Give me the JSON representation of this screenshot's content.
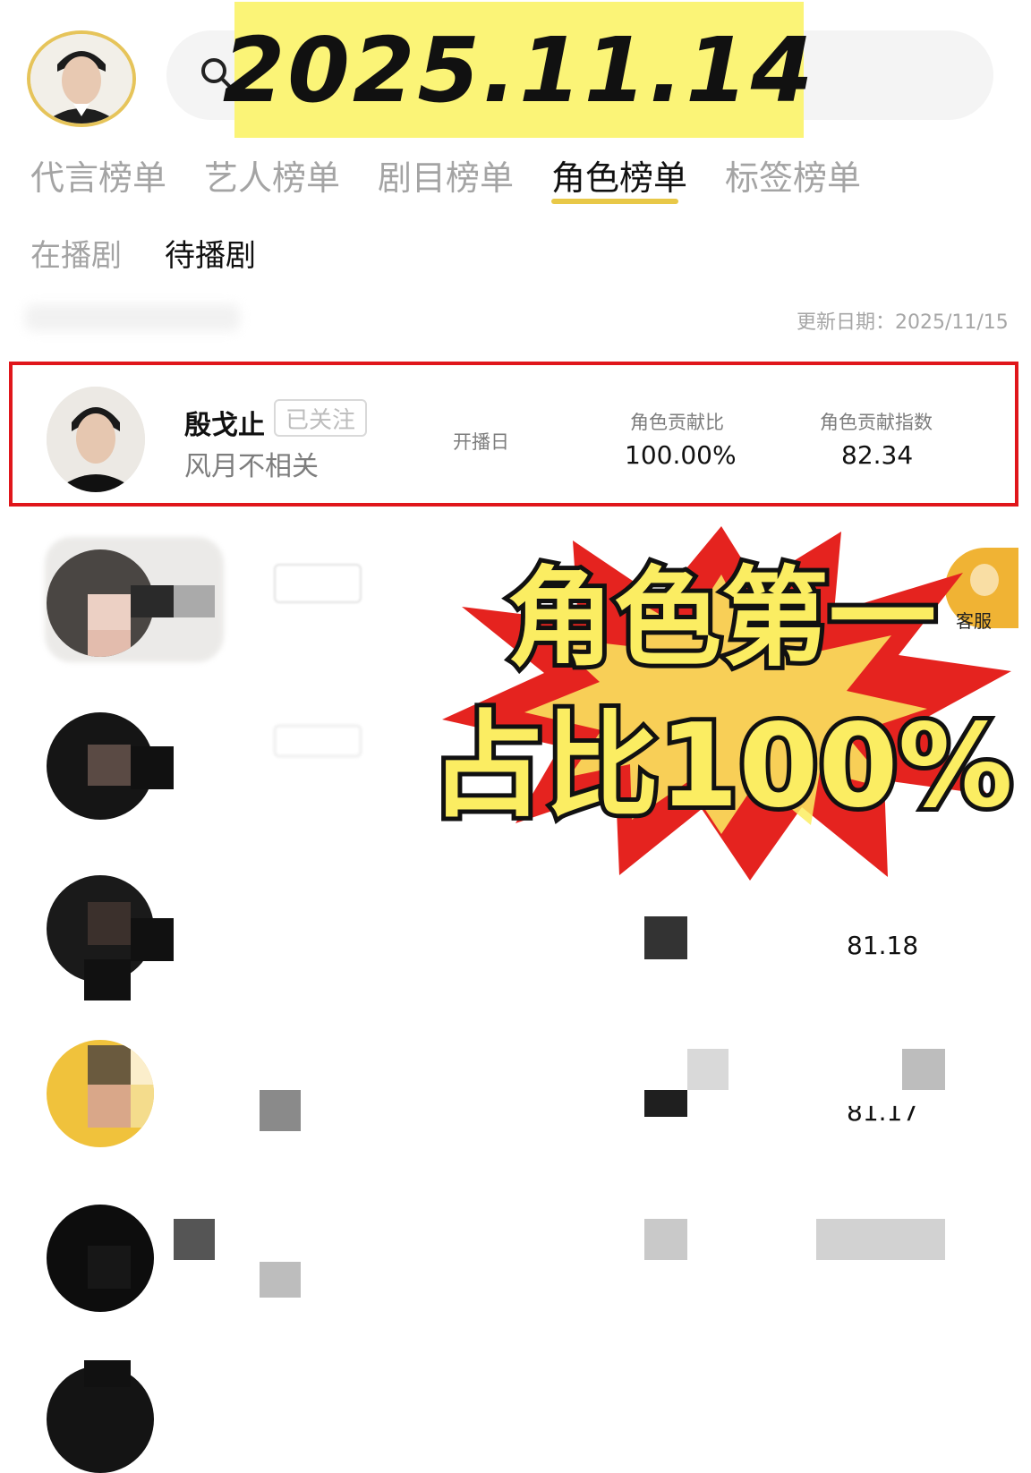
{
  "header": {
    "date_banner": "2025.11.14",
    "search_icon": "search-icon"
  },
  "tabs": [
    {
      "label": "代言榜单",
      "active": false
    },
    {
      "label": "艺人榜单",
      "active": false
    },
    {
      "label": "剧目榜单",
      "active": false
    },
    {
      "label": "角色榜单",
      "active": true
    },
    {
      "label": "标签榜单",
      "active": false
    }
  ],
  "subtabs": [
    {
      "label": "在播剧",
      "active": false
    },
    {
      "label": "待播剧",
      "active": true
    }
  ],
  "update_date": "更新日期：2025/11/15",
  "top_entry": {
    "name": "殷戈止",
    "follow_label": "已关注",
    "show": "风月不相关",
    "air_date_label": "开播日",
    "contribution_ratio_label": "角色贡献比",
    "contribution_ratio_value": "100.00%",
    "contribution_index_label": "角色贡献指数",
    "contribution_index_value": "82.34"
  },
  "sticker": {
    "line1": "角色第一",
    "line2": "占比100%"
  },
  "customer_service_label": "客服",
  "blurred_rows": [
    {
      "index_value": ""
    },
    {
      "index_value": ""
    },
    {
      "index_value": "81.18"
    },
    {
      "index_value": "81.17"
    },
    {
      "index_value": ""
    }
  ],
  "colors": {
    "highlight_border": "#e0161b",
    "tab_underline": "#e8c848",
    "date_banner_bg": "#fbf477",
    "sticker_red": "#e5231f",
    "sticker_yellow": "#fbed62"
  }
}
